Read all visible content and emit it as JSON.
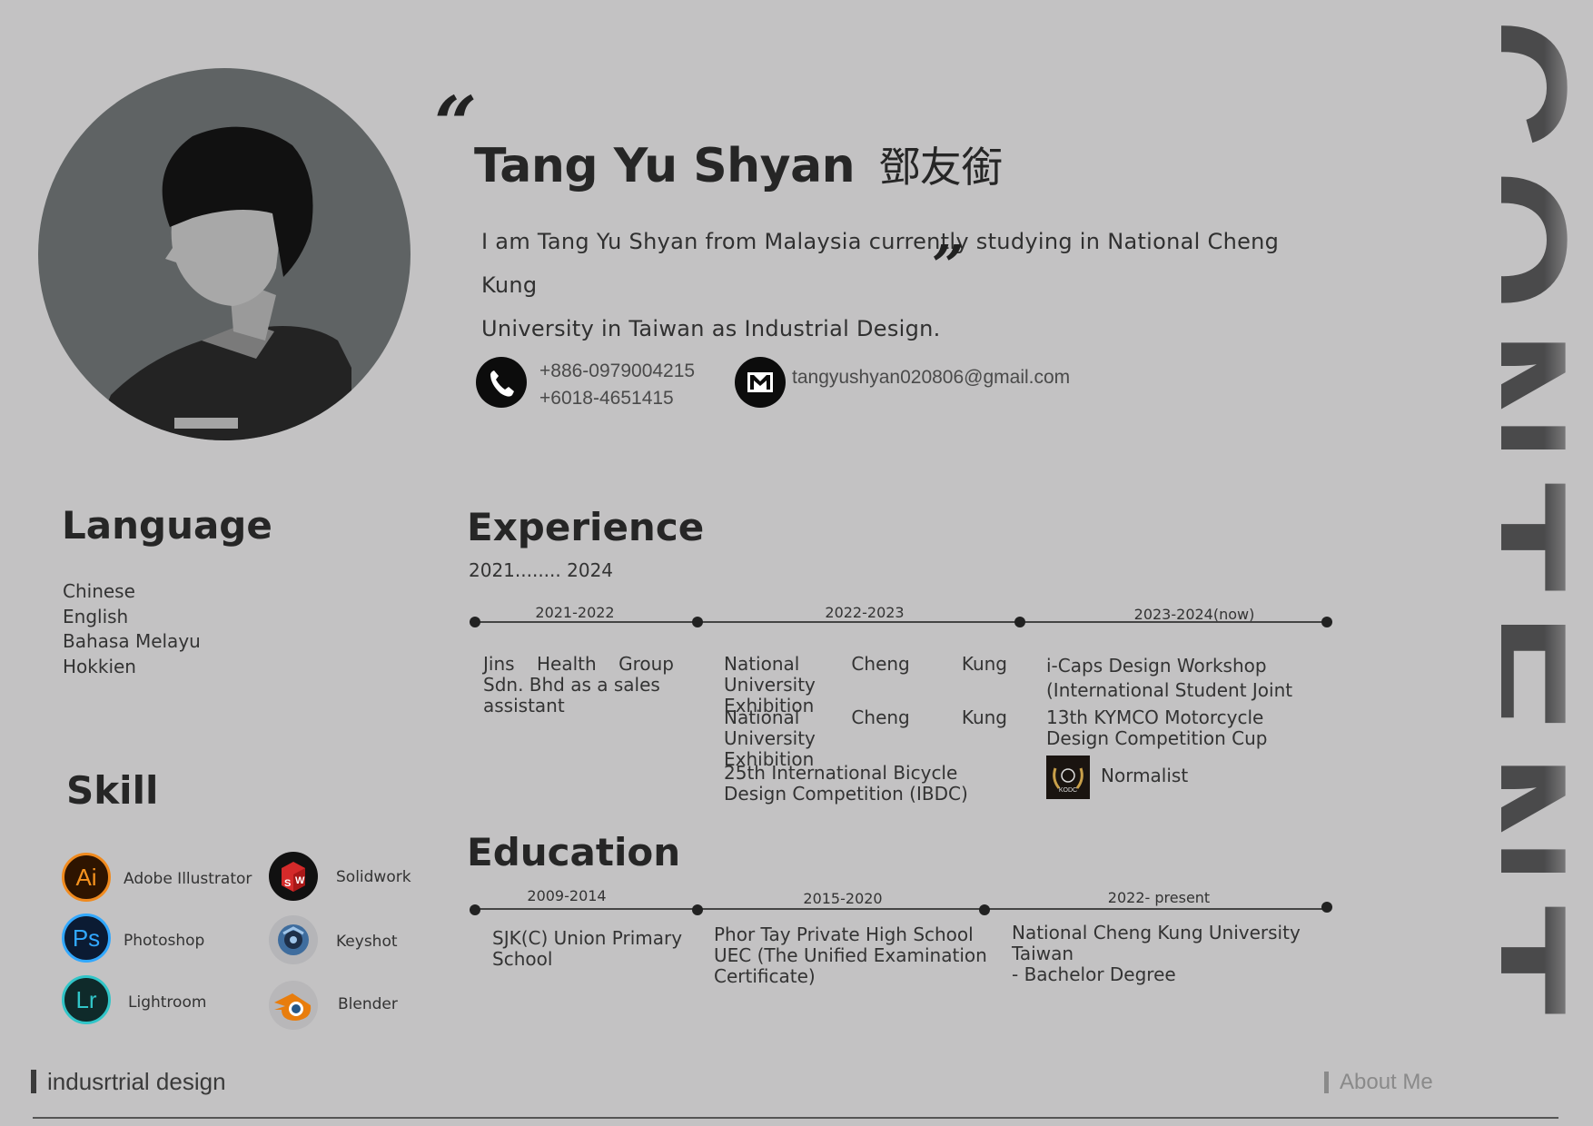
{
  "header": {
    "name": "Tang Yu Shyan",
    "name_cjk": "鄧友銜",
    "quote_open": "“",
    "quote_close": "”",
    "intro_line1": "I am Tang Yu Shyan from Malaysia currently studying in National Cheng Kung",
    "intro_line2": "University in Taiwan as Industrial Design."
  },
  "contact": {
    "phone1": "+886-0979004215",
    "phone2": "+6018-4651415",
    "email": "tangyushyan020806@gmail.com"
  },
  "language": {
    "title": "Language",
    "items": [
      "Chinese",
      "English",
      "Bahasa Melayu",
      "Hokkien"
    ]
  },
  "skill": {
    "title": "Skill",
    "items": [
      {
        "label": "Adobe Illustrator",
        "abbr": "Ai",
        "icon": "adobe-illustrator-icon"
      },
      {
        "label": "Solidwork",
        "abbr": "SW",
        "icon": "solidworks-icon"
      },
      {
        "label": "Photoshop",
        "abbr": "Ps",
        "icon": "photoshop-icon"
      },
      {
        "label": "Keyshot",
        "abbr": "",
        "icon": "keyshot-icon"
      },
      {
        "label": "Lightroom",
        "abbr": "Lr",
        "icon": "lightroom-icon"
      },
      {
        "label": "Blender",
        "abbr": "",
        "icon": "blender-icon"
      }
    ]
  },
  "experience": {
    "title": "Experience",
    "period": "2021........ 2024",
    "labels": [
      "2021-2022",
      "2022-2023",
      "2023-2024(now)"
    ],
    "col1": [
      "Jins Health Group Sdn. Bhd as a sales",
      "assistant"
    ],
    "col2": [
      [
        "National Cheng Kung University",
        "Exhibition"
      ],
      [
        "National Cheng Kung University",
        "Exhibition"
      ],
      [
        "25th International Bicycle",
        "Design Competition (IBDC)"
      ]
    ],
    "col3": {
      "item1": [
        "i-Caps Design Workshop",
        "(International Student Joint"
      ],
      "item2": [
        "13th KYMCO Motorcycle",
        "Design Competition Cup"
      ],
      "item3": "Normalist",
      "badge_text": "KODC"
    }
  },
  "education": {
    "title": "Education",
    "labels": [
      "2009-2014",
      "2015-2020",
      "2022- present"
    ],
    "col1": [
      "SJK(C) Union Primary",
      "School"
    ],
    "col2": [
      "Phor Tay Private High School",
      "UEC (The Unified Examination",
      "Certificate)"
    ],
    "col3": [
      "National Cheng Kung University",
      "Taiwan",
      "- Bachelor Degree"
    ]
  },
  "footer": {
    "left": "indusrtrial design",
    "right": "About Me"
  },
  "side_word": "CONTENT",
  "colors": {
    "background": "#c3c2c3",
    "photo_bg": "#5f6364",
    "text": "#262626",
    "side_word": "#4a4a4b"
  }
}
